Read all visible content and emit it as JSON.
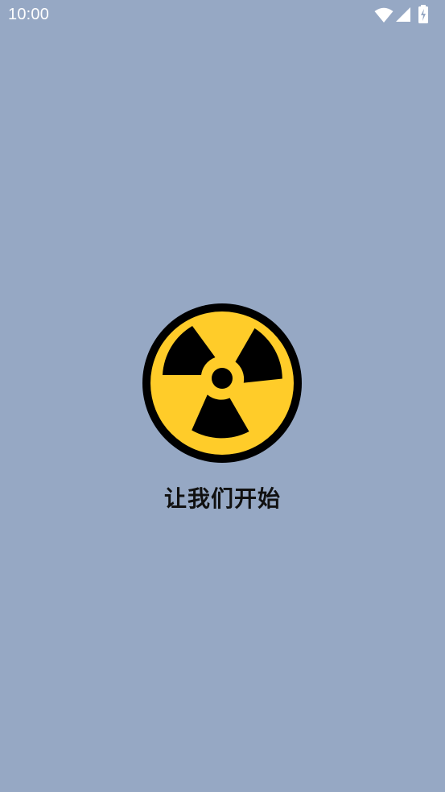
{
  "status_bar": {
    "time": "10:00",
    "icons": [
      "wifi-icon",
      "cellular-signal-icon",
      "battery-charging-icon"
    ],
    "icon_color": "#ffffff"
  },
  "splash": {
    "logo_icon": "radiation-icon",
    "logo_colors": {
      "fill": "#FFCC29",
      "outline": "#000000"
    },
    "tagline": "让我们开始"
  },
  "colors": {
    "background": "#96A8C4",
    "text": "#111111"
  }
}
